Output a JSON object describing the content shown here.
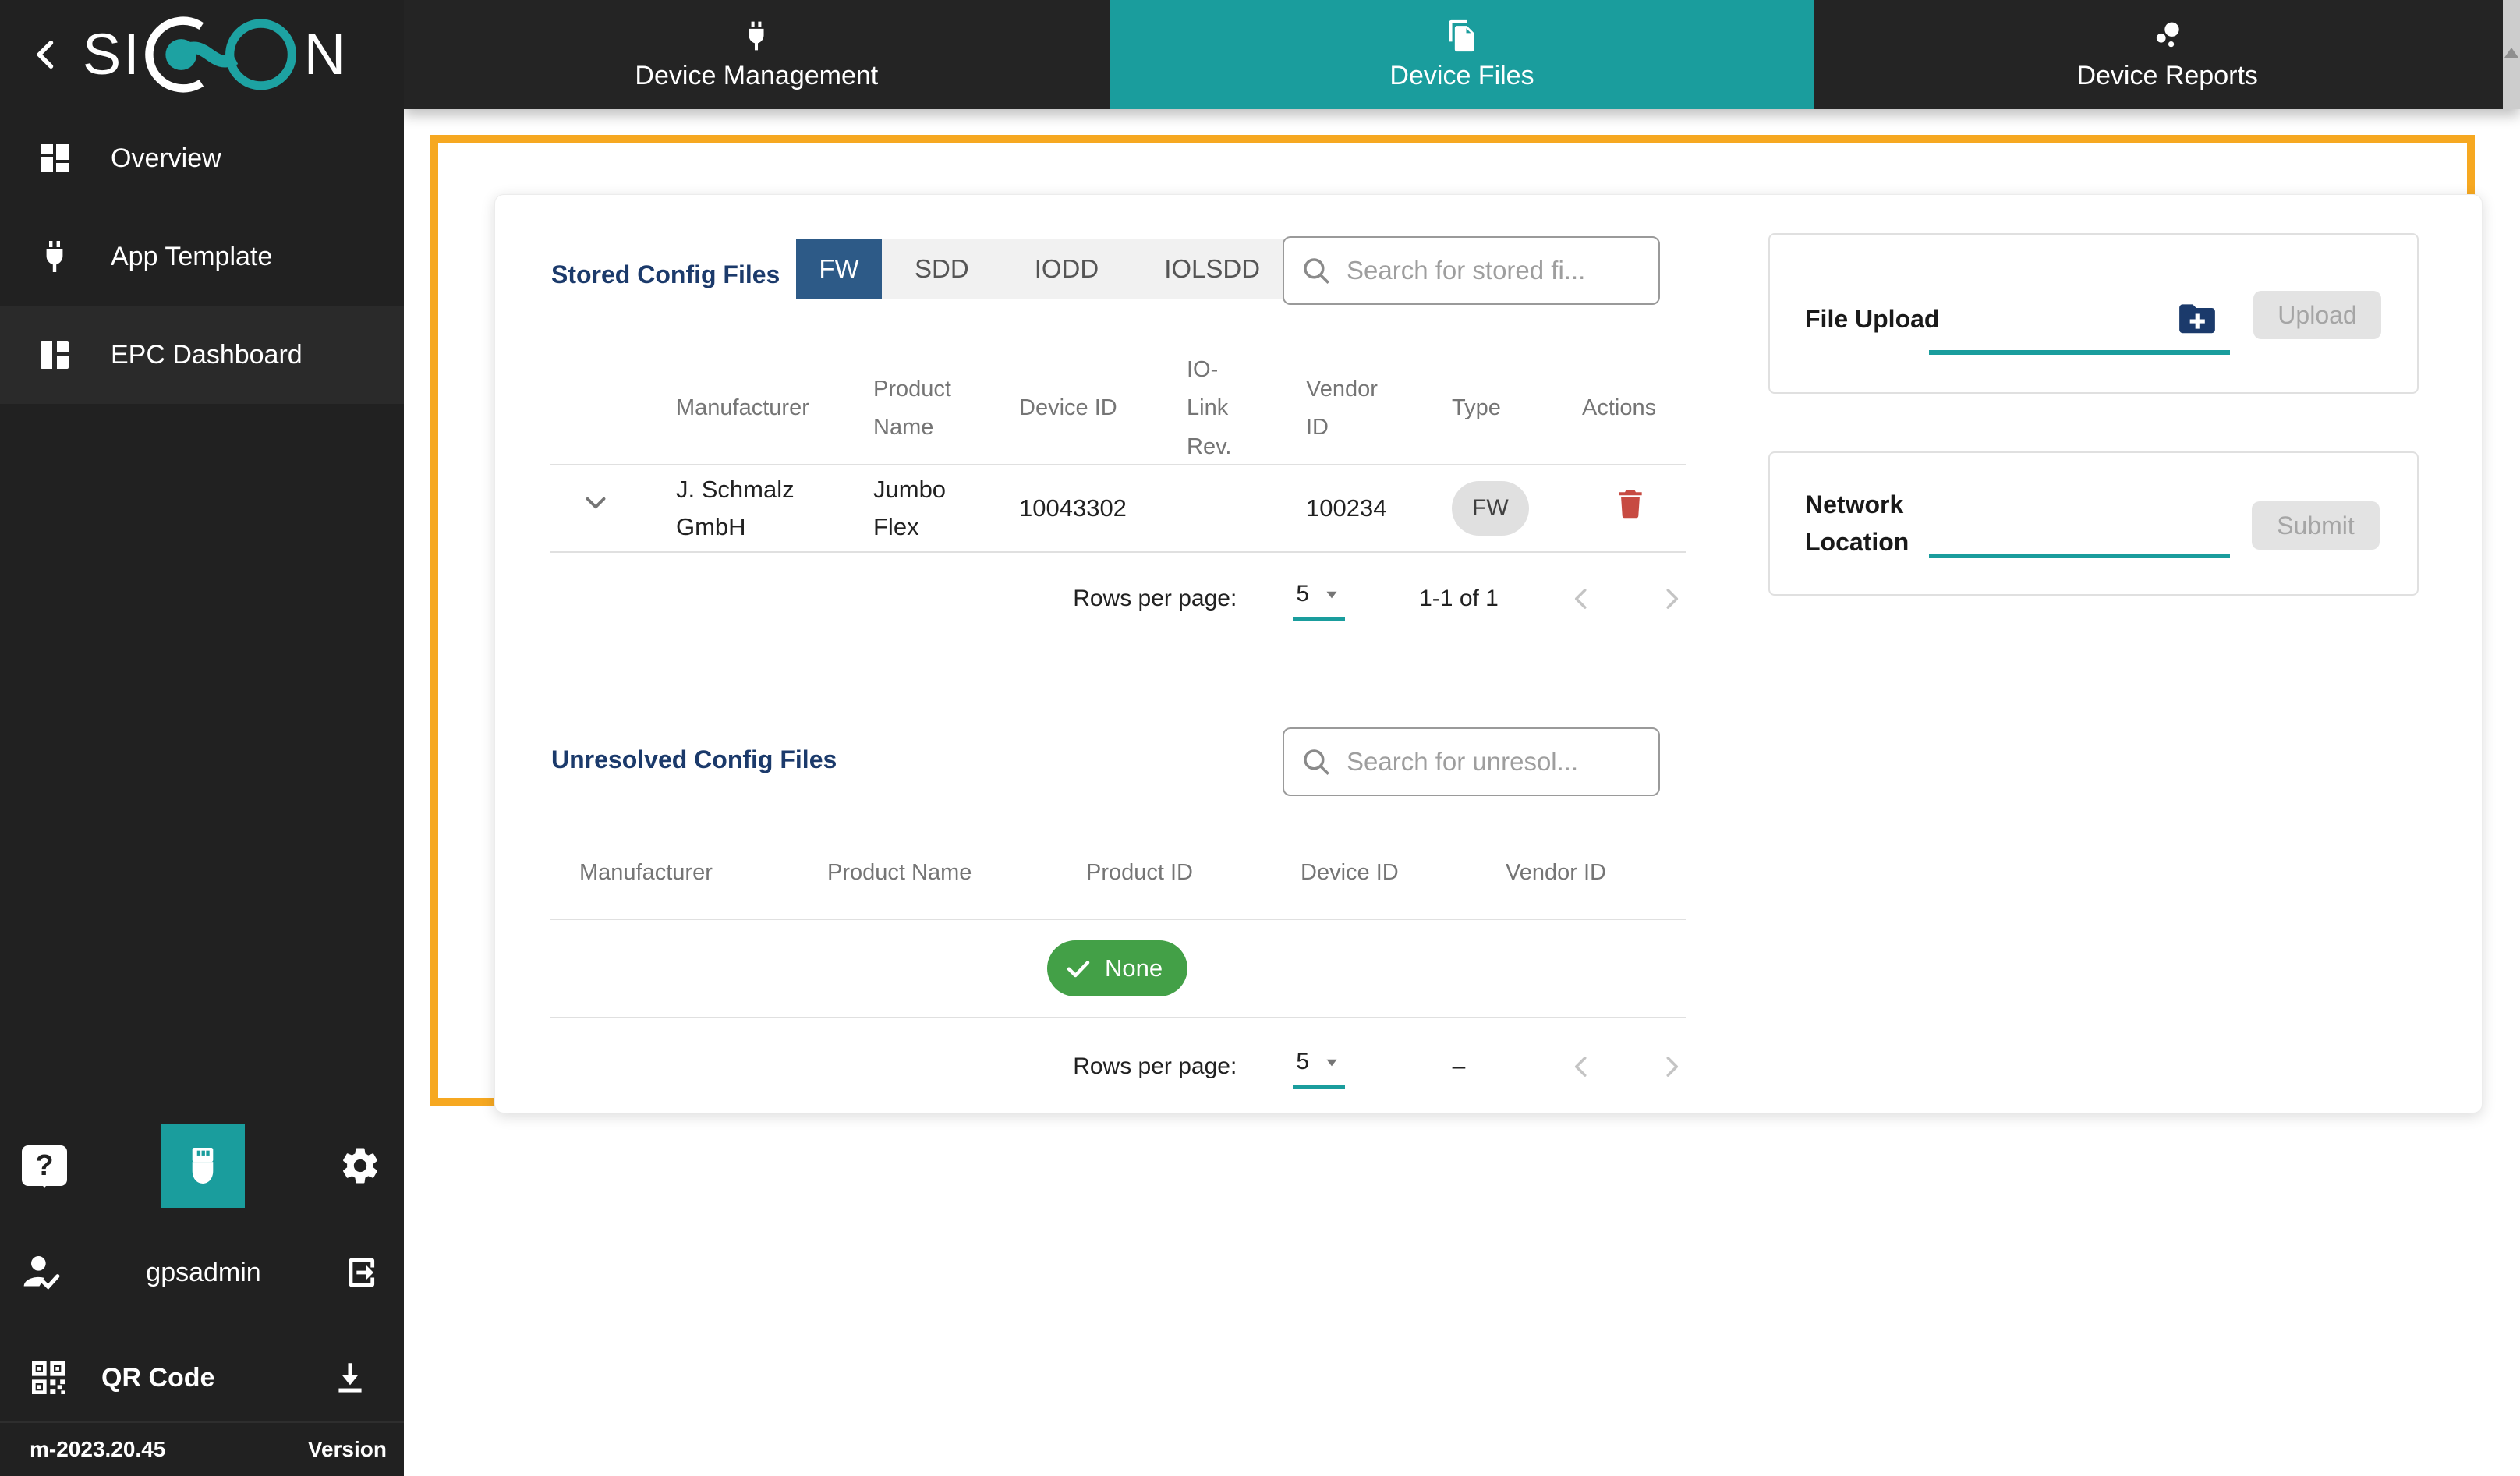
{
  "app": {
    "logo_text": "SICON",
    "logo_left": "SI",
    "logo_right": "N",
    "user": "gpsadmin",
    "version": "m-2023.20.45",
    "version_label": "Version"
  },
  "sidebar": {
    "items": [
      {
        "label": "Overview",
        "icon": "dashboard-icon"
      },
      {
        "label": "App Template",
        "icon": "plug-icon"
      },
      {
        "label": "EPC Dashboard",
        "icon": "space-dashboard-icon",
        "active": true
      }
    ],
    "qr_label": "QR Code"
  },
  "topnav": {
    "tabs": [
      {
        "label": "Device Management",
        "icon": "plug-icon",
        "active": false
      },
      {
        "label": "Device Files",
        "icon": "file-copy-icon",
        "active": true
      },
      {
        "label": "Device Reports",
        "icon": "bubble-chart-icon",
        "active": false
      }
    ]
  },
  "stored": {
    "title": "Stored Config Files",
    "filter_tabs": [
      "FW",
      "SDD",
      "IODD",
      "IOLSDD"
    ],
    "active_filter_tab": "FW",
    "search_placeholder": "Search for stored fi...",
    "columns": [
      "Manufacturer",
      "Product Name",
      "Device ID",
      "IO-Link Rev.",
      "Vendor ID",
      "Type",
      "Actions"
    ],
    "rows": [
      {
        "manufacturer": "J. Schmalz GmbH",
        "product_name": "Jumbo Flex",
        "device_id": "10043302",
        "io_link_rev": "",
        "vendor_id": "100234",
        "type": "FW"
      }
    ],
    "pagination": {
      "rows_per_page_label": "Rows per page:",
      "rows_per_page": "5",
      "range": "1-1 of 1"
    }
  },
  "unresolved": {
    "title": "Unresolved Config Files",
    "search_placeholder": "Search for unresol...",
    "columns": [
      "Manufacturer",
      "Product Name",
      "Product ID",
      "Device ID",
      "Vendor ID"
    ],
    "empty_label": "None",
    "pagination": {
      "rows_per_page_label": "Rows per page:",
      "rows_per_page": "5",
      "range": "–"
    }
  },
  "file_upload": {
    "title": "File Upload",
    "button": "Upload"
  },
  "network_location": {
    "title": "Network Location",
    "button": "Submit"
  },
  "colors": {
    "teal_accent": "#1a9d9d",
    "orange_highlight": "#f6a821",
    "navy_heading": "#1b3a6b",
    "filter_tab_blue": "#2d5a87",
    "success_green": "#43a047",
    "delete_red": "#c74b42",
    "chip_gray": "#e0e0e0",
    "dark_chrome": "#212121"
  }
}
